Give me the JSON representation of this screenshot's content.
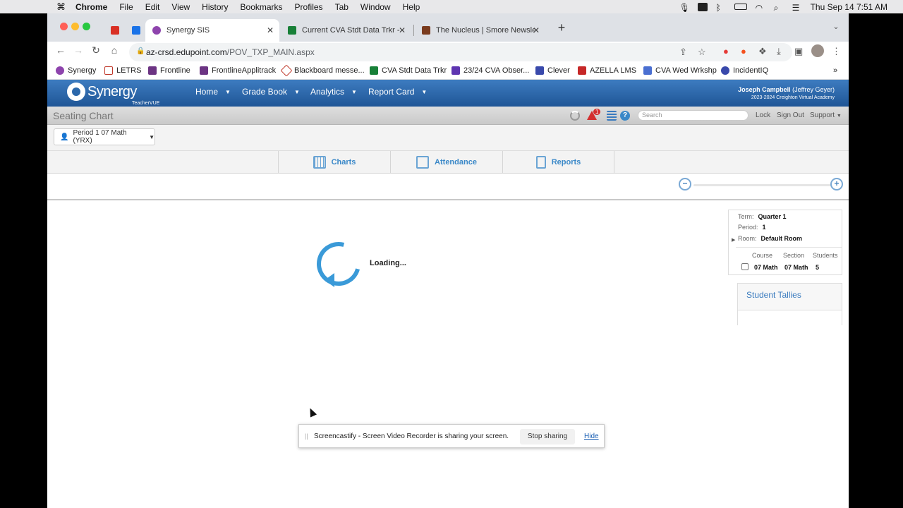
{
  "menubar": {
    "apple": "",
    "items": [
      "Chrome",
      "File",
      "Edit",
      "View",
      "History",
      "Bookmarks",
      "Profiles",
      "Tab",
      "Window",
      "Help"
    ],
    "clock": "Thu Sep 14  7:51 AM"
  },
  "browser": {
    "tabs": [
      {
        "title": "",
        "icon_color": "#d93025",
        "icon": "gmail-icon"
      },
      {
        "title": "",
        "icon_color": "#1a73e8",
        "icon": "calendar-icon"
      },
      {
        "title": "Synergy SIS",
        "icon_color": "#8e44ad",
        "icon": "synergy-icon"
      },
      {
        "title": "Current CVA Stdt Data Trkr - G",
        "icon_color": "#188038",
        "icon": "sheets-icon"
      },
      {
        "title": "The Nucleus | Smore Newslette",
        "icon_color": "#7a3b1e",
        "icon": "smore-icon"
      }
    ],
    "new_tab": "+",
    "url_host": "az-crsd.edupoint.com",
    "url_path": "/POV_TXP_MAIN.aspx",
    "bookmarks": [
      {
        "label": "Synergy",
        "color": "#8e44ad"
      },
      {
        "label": "LETRS",
        "color": "#c0392b"
      },
      {
        "label": "Frontline",
        "color": "#6c3483"
      },
      {
        "label": "FrontlineApplitrack",
        "color": "#6c3483"
      },
      {
        "label": "Blackboard messe...",
        "color": "#c0392b"
      },
      {
        "label": "CVA Stdt Data Trkr",
        "color": "#188038"
      },
      {
        "label": "23/24 CVA Obser...",
        "color": "#5e35b1"
      },
      {
        "label": "Clever",
        "color": "#3949ab"
      },
      {
        "label": "AZELLA LMS",
        "color": "#c62828"
      },
      {
        "label": "CVA Wed Wrkshp",
        "color": "#4a6fd1"
      },
      {
        "label": "IncidentIQ",
        "color": "#3949ab"
      }
    ],
    "bookmarks_more": "»"
  },
  "app": {
    "logo_text": "Synergy",
    "logo_sub": "TeacherVUE",
    "nav": [
      "Home",
      "Grade Book",
      "Analytics",
      "Report Card"
    ],
    "user_name": "Joseph Campbell",
    "user_proxy": "(Jeffrey Geyer)",
    "user_school": "2023-2024 Creighton Virtual Academy",
    "page_title": "Seating Chart",
    "search_placeholder": "Search",
    "alert_count": "1",
    "links": [
      "Lock",
      "Sign Out",
      "Support"
    ],
    "period_selector": "Period 1 07 Math (YRX)",
    "tabs": [
      "Charts",
      "Attendance",
      "Reports"
    ],
    "loading_text": "Loading...",
    "info": {
      "term_label": "Term:",
      "term": "Quarter 1",
      "period_label": "Period:",
      "period": "1",
      "room_label": "Room:",
      "room": "Default Room",
      "course_header": "Course",
      "section_header": "Section",
      "students_header": "Students",
      "course": "07 Math",
      "section": "07 Math",
      "students": "5"
    },
    "tallies_title": "Student Tallies"
  },
  "share_bar": {
    "text": "Screencastify - Screen Video Recorder is sharing your screen.",
    "stop": "Stop sharing",
    "hide": "Hide"
  }
}
